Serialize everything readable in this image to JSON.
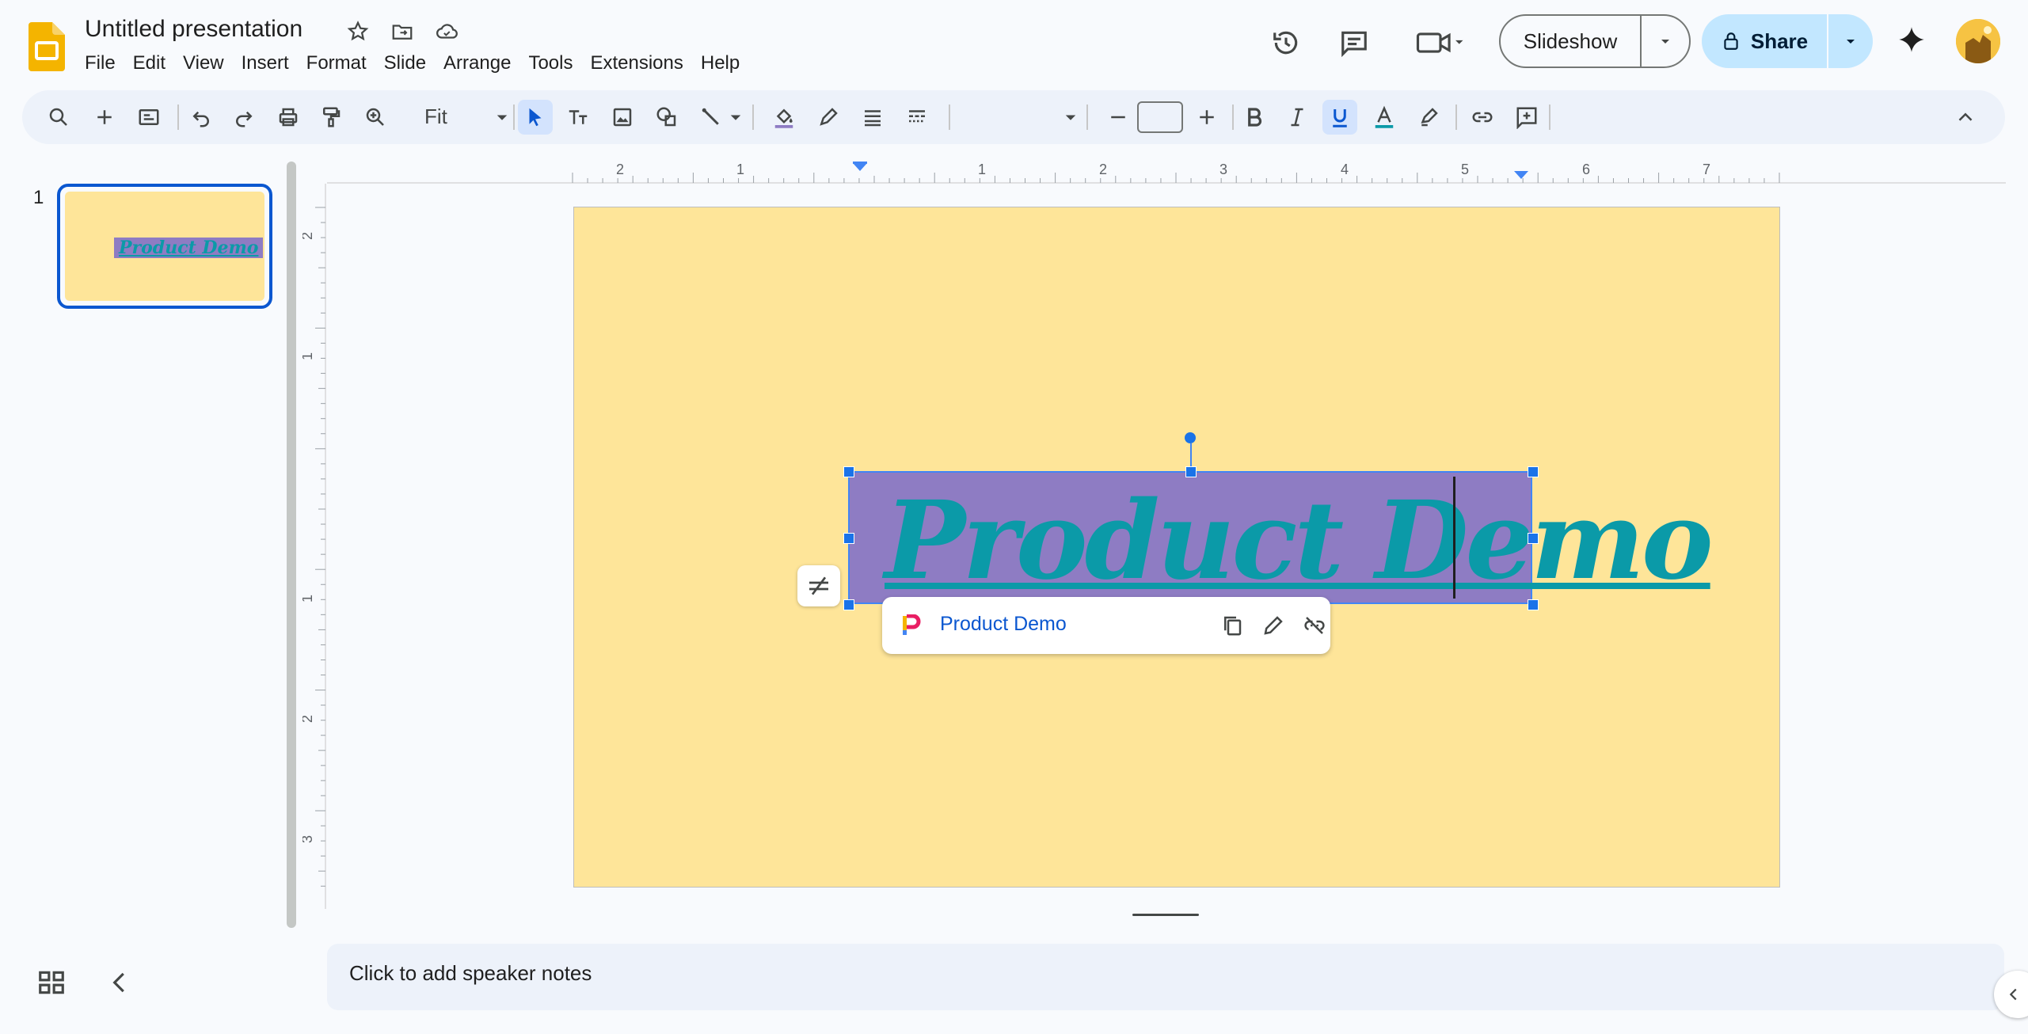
{
  "app": {
    "title": "Untitled presentation",
    "menus": [
      "File",
      "Edit",
      "View",
      "Insert",
      "Format",
      "Slide",
      "Arrange",
      "Tools",
      "Extensions",
      "Help"
    ],
    "slideshow_label": "Slideshow",
    "share_label": "Share"
  },
  "toolbar": {
    "zoom": "Fit",
    "font_size": ""
  },
  "filmstrip": {
    "slide_number": "1",
    "thumb_text": "Product Demo"
  },
  "ruler": {
    "horizontal": [
      "2",
      "1",
      "1",
      "2",
      "3",
      "4",
      "5",
      "6",
      "7"
    ],
    "vertical": [
      "2",
      "1",
      "1",
      "2",
      "3"
    ]
  },
  "slide": {
    "text": "Product Demo",
    "link_chip_text": "Product Demo"
  },
  "notes": {
    "placeholder": "Click to add speaker notes"
  },
  "colors": {
    "slide_bg": "#fee599",
    "textbox_fill": "#8e7cc3",
    "text_color": "#0b9aa8",
    "accent": "#0b57d0"
  }
}
